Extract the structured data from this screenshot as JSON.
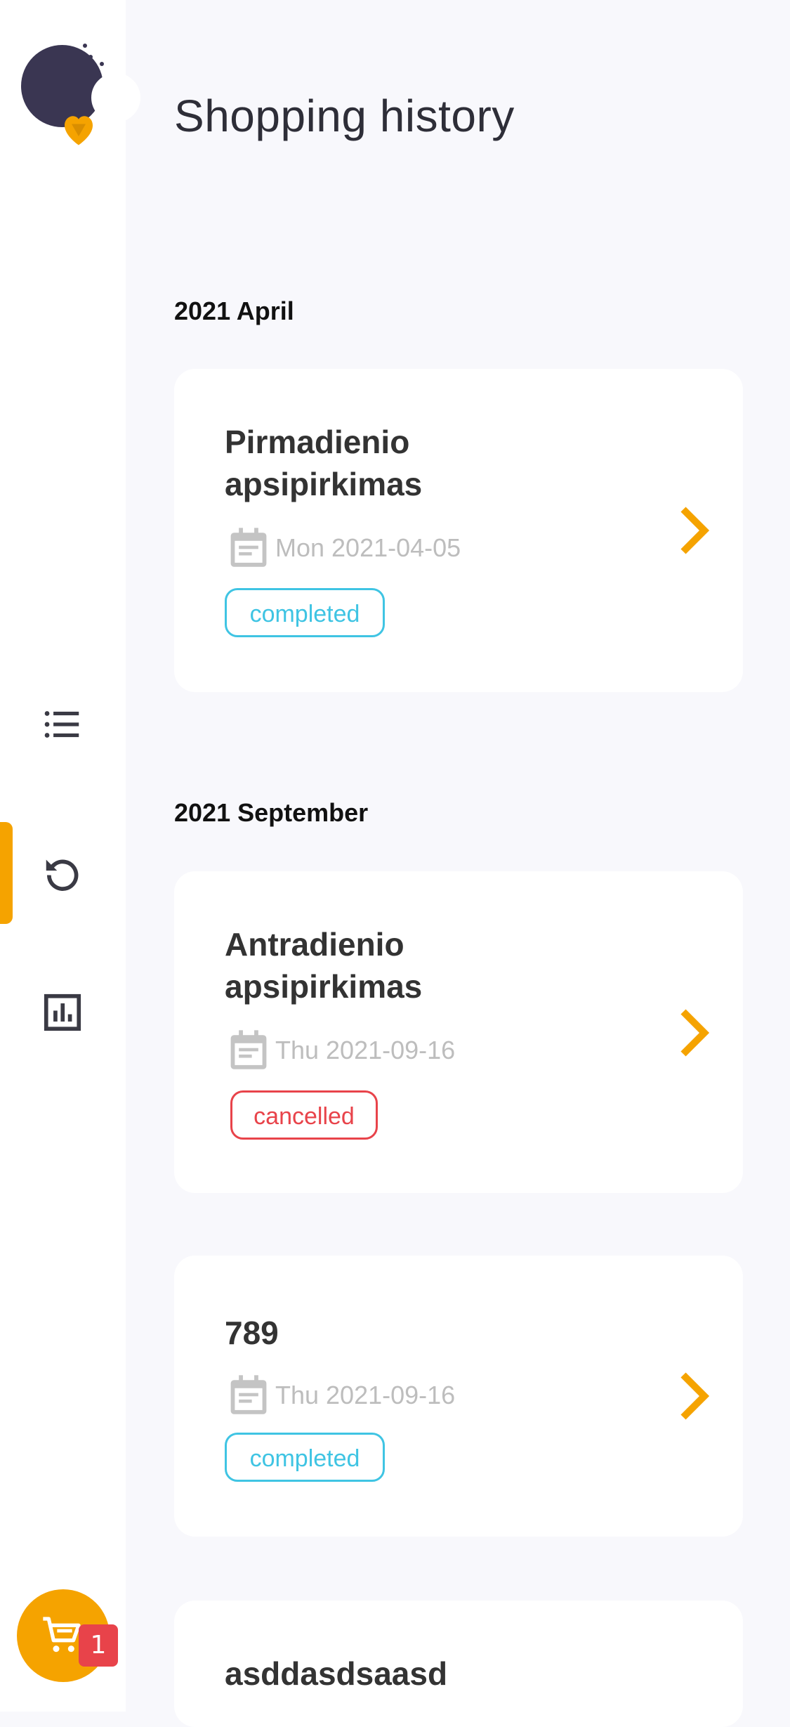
{
  "page": {
    "title": "Shopping history"
  },
  "sidebar": {
    "items": [
      {
        "name": "list",
        "icon": "list-icon",
        "active": false
      },
      {
        "name": "history",
        "icon": "history-icon",
        "active": true
      },
      {
        "name": "stats",
        "icon": "bar-chart-icon",
        "active": false
      }
    ]
  },
  "cart": {
    "icon": "cart-icon",
    "badge": "1"
  },
  "groups": [
    {
      "month": "2021 April",
      "orders": [
        {
          "title": "Pirmadienio apsipirkimas",
          "date": "Mon 2021-04-05",
          "status": "completed"
        }
      ]
    },
    {
      "month": "2021 September",
      "orders": [
        {
          "title": "Antradienio apsipirkimas",
          "date": "Thu 2021-09-16",
          "status": "cancelled"
        },
        {
          "title": "789",
          "date": "Thu 2021-09-16",
          "status": "completed"
        },
        {
          "title": "asddasdsaasd"
        }
      ]
    }
  ],
  "colors": {
    "accent": "#f5a300",
    "completed": "#3fc4e3",
    "cancelled": "#e8434a",
    "logo_bg": "#3a3652"
  }
}
